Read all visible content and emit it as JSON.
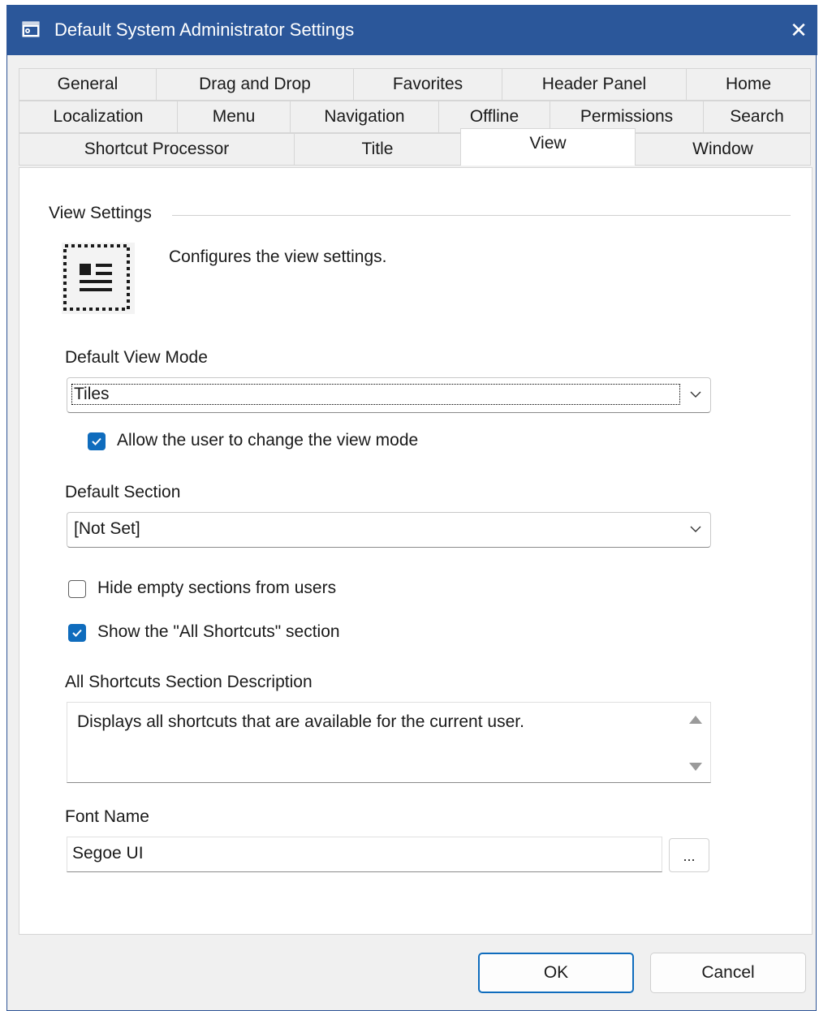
{
  "window": {
    "title": "Default System Administrator Settings",
    "close_glyph": "✕"
  },
  "tabs": {
    "row1": [
      "General",
      "Drag and Drop",
      "Favorites",
      "Header Panel",
      "Home"
    ],
    "row2": [
      "Localization",
      "Menu",
      "Navigation",
      "Offline",
      "Permissions",
      "Search"
    ],
    "row3": [
      "Shortcut Processor",
      "Title",
      "View",
      "Window"
    ],
    "active": "View"
  },
  "panel": {
    "group_title": "View Settings",
    "description": "Configures the view settings.",
    "view_mode": {
      "label": "Default View Mode",
      "value": "Tiles"
    },
    "allow_change": {
      "label": "Allow the user to change the view mode",
      "checked": true
    },
    "section": {
      "label": "Default Section",
      "value": "[Not Set]"
    },
    "hide_empty": {
      "label": "Hide empty sections from users",
      "checked": false
    },
    "show_all": {
      "label": "Show the \"All Shortcuts\" section",
      "checked": true
    },
    "all_desc": {
      "label": "All Shortcuts Section Description",
      "value": "Displays all shortcuts that are available for the current user."
    },
    "font": {
      "label": "Font Name",
      "value": "Segoe UI",
      "browse": "..."
    }
  },
  "buttons": {
    "ok": "OK",
    "cancel": "Cancel"
  },
  "colors": {
    "titlebar": "#2b579a",
    "accent": "#0f6cbd"
  }
}
